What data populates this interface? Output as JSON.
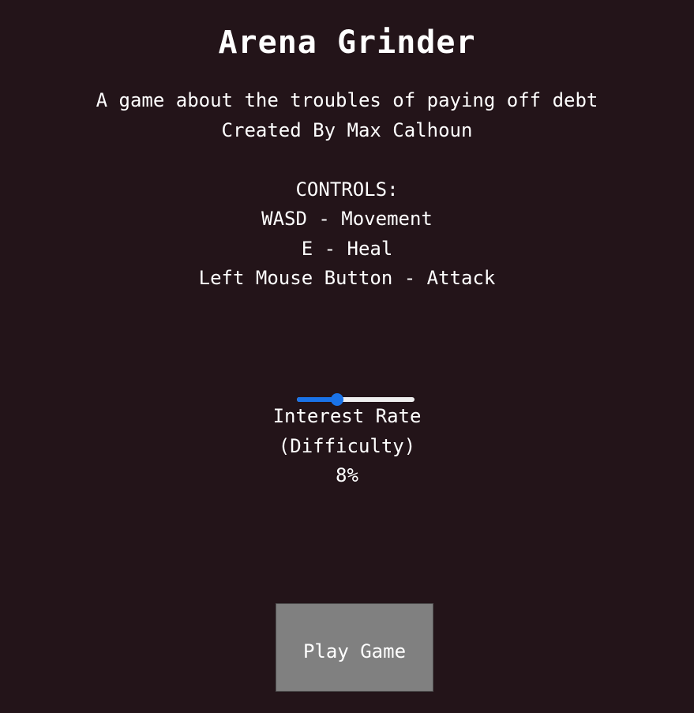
{
  "game": {
    "title": "Arena Grinder",
    "tagline": "A game about the troubles of paying off debt",
    "credits": "Created By Max Calhoun",
    "controls": {
      "header": "CONTROLS:",
      "lines": [
        "WASD - Movement",
        "E - Heal",
        "Left Mouse Button - Attack"
      ]
    }
  },
  "difficulty_slider": {
    "label_line1": "Interest Rate",
    "label_line2": "(Difficulty)",
    "value_text": "8%",
    "value_fraction": 0.32,
    "accent_color": "#1a73e8",
    "track_color": "#efefef"
  },
  "play_button": {
    "label": "Play Game",
    "color": "#808080"
  },
  "background_color": "#231419"
}
